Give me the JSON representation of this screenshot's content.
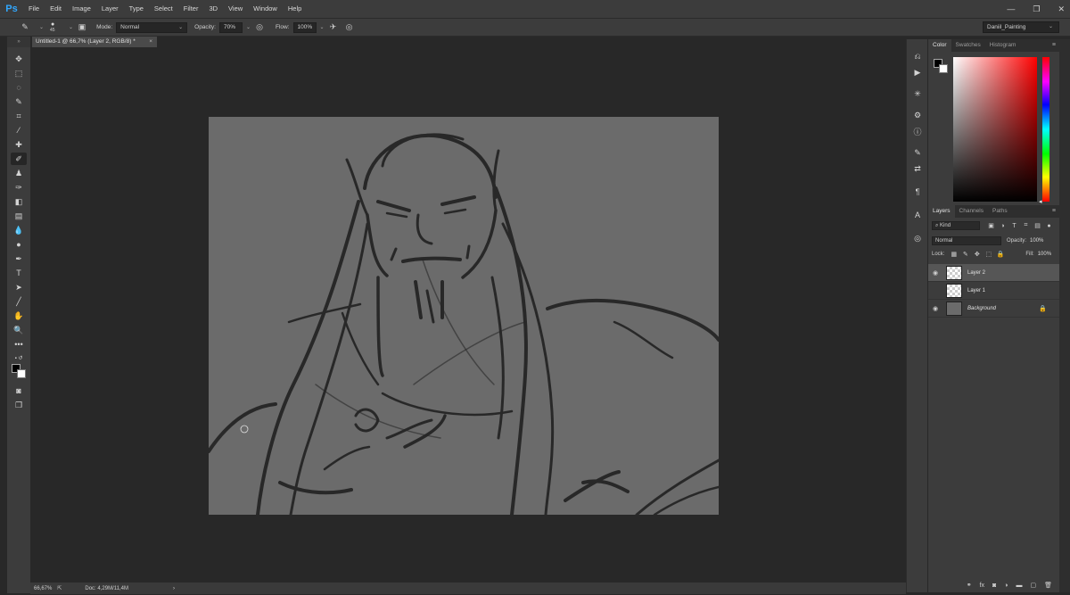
{
  "app": {
    "logo": "Ps"
  },
  "menu": [
    "File",
    "Edit",
    "Image",
    "Layer",
    "Type",
    "Select",
    "Filter",
    "3D",
    "View",
    "Window",
    "Help"
  ],
  "window_controls": {
    "minimize": "—",
    "restore": "❐",
    "close": "✕"
  },
  "options": {
    "brush_size": "45",
    "mode_label": "Mode:",
    "mode_value": "Normal",
    "opacity_label": "Opacity:",
    "opacity_value": "70%",
    "flow_label": "Flow:",
    "flow_value": "100%",
    "workspace": "Daniil_Painting"
  },
  "document": {
    "tab_title": "Untitled-1 @ 66,7% (Layer 2, RGB/8) *",
    "close": "×"
  },
  "status": {
    "zoom": "66,67%",
    "doc_info": "Doc: 4,29M/11,4M",
    "arrow": "›"
  },
  "color_panel": {
    "tabs": [
      "Color",
      "Swatches",
      "Histogram"
    ],
    "foreground": "#000000",
    "background": "#ffffff"
  },
  "layers_panel": {
    "tabs": [
      "Layers",
      "Channels",
      "Paths"
    ],
    "filter_kind": "Kind",
    "blend_mode": "Normal",
    "opacity_label": "Opacity:",
    "opacity_value": "100%",
    "lock_label": "Lock:",
    "fill_label": "Fill:",
    "fill_value": "100%",
    "layers": [
      {
        "name": "Layer 2",
        "visible": true,
        "selected": true
      },
      {
        "name": "Layer 1",
        "visible": false,
        "selected": false
      },
      {
        "name": "Background",
        "visible": true,
        "selected": false,
        "locked": true
      }
    ]
  },
  "canvas_color": "#6b6b6b"
}
